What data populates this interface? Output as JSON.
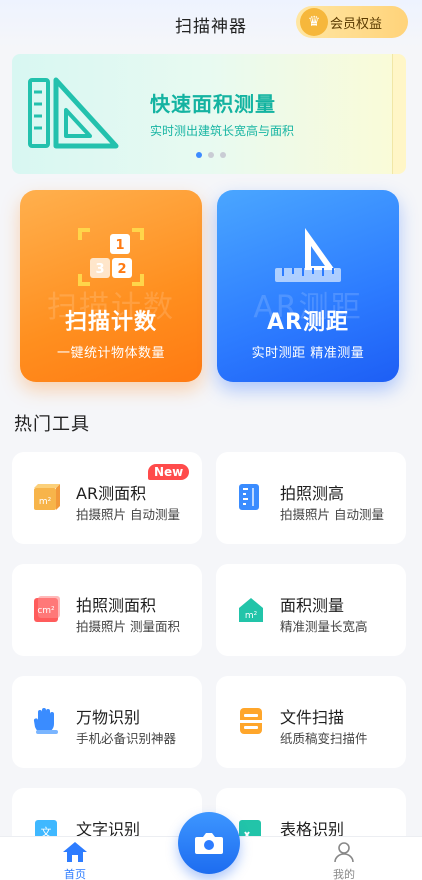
{
  "header": {
    "title": "扫描神器",
    "vip_label": "会员权益"
  },
  "banner": {
    "title": "快速面积测量",
    "subtitle": "实时测出建筑长宽高与面积"
  },
  "feature_cards": [
    {
      "title": "扫描计数",
      "subtitle": "一键统计物体数量",
      "watermark": "扫描计数"
    },
    {
      "title": "AR测距",
      "subtitle": "实时测距 精准测量",
      "watermark": "AR测距"
    }
  ],
  "section_title": "热门工具",
  "tools": [
    {
      "name": "AR测面积",
      "desc": "拍摄照片 自动测量",
      "badge": "New",
      "icon_text": "m²"
    },
    {
      "name": "拍照测高",
      "desc": "拍摄照片 自动测量"
    },
    {
      "name": "拍照测面积",
      "desc": "拍摄照片 测量面积",
      "icon_text": "cm²"
    },
    {
      "name": "面积测量",
      "desc": "精准测量长宽高",
      "icon_text": "m²"
    },
    {
      "name": "万物识别",
      "desc": "手机必备识别神器"
    },
    {
      "name": "文件扫描",
      "desc": "纸质稿变扫描件"
    },
    {
      "name": "文字识别",
      "desc": "",
      "icon_text": "文"
    },
    {
      "name": "表格识别",
      "desc": ""
    }
  ],
  "tabbar": {
    "home": "首页",
    "mine": "我的"
  },
  "colors": {
    "accent_blue": "#2d7cff",
    "accent_orange": "#ff8f1f",
    "teal": "#14b3a1"
  }
}
